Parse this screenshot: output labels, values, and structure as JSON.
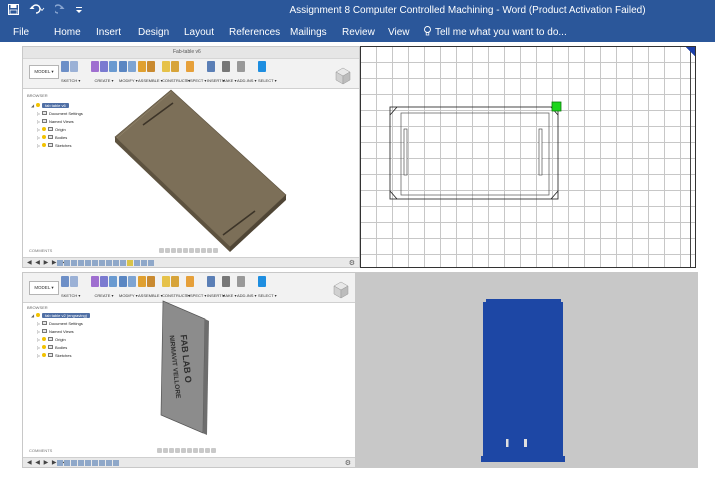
{
  "window": {
    "title": "Assignment 8 Computer Controlled Machining - Word (Product Activation Failed)",
    "save_icon": "save-icon",
    "undo_icon": "undo-icon",
    "redo_icon": "redo-icon",
    "customize_icon": "customize-quick-access-icon"
  },
  "ribbon": {
    "tabs": [
      "File",
      "Home",
      "Insert",
      "Design",
      "Layout",
      "References",
      "Mailings",
      "Review",
      "View"
    ],
    "tell_me": "Tell me what you want to do..."
  },
  "fusion_top": {
    "file_name": "Fab-table v6",
    "model_label": "MODEL ▾",
    "toolbar_groups": [
      "SKETCH ▾",
      "CREATE ▾",
      "MODIFY ▾",
      "ASSEMBLE ▾",
      "CONSTRUCT ▾",
      "INSPECT ▾",
      "INSERT ▾",
      "MAKE ▾",
      "ADD-INS ▾",
      "SELECT ▾"
    ],
    "browser_label": "BROWSER",
    "root_label": "fab table v6",
    "tree": [
      "Document Settings",
      "Named Views",
      "Origin",
      "Bodies",
      "Sketches"
    ],
    "comments_label": "COMMENTS"
  },
  "fusion_bottom": {
    "model_label": "MODEL ▾",
    "toolbar_groups": [
      "SKETCH ▾",
      "CREATE ▾",
      "MODIFY ▾",
      "ASSEMBLE ▾",
      "CONSTRUCT ▾",
      "INSPECT ▾",
      "INSERT ▾",
      "MAKE ▾",
      "ADD-INS ▾",
      "SELECT ▾"
    ],
    "browser_label": "BROWSER",
    "root_label": "fab table v2 (engraving)",
    "tree": [
      "Document Settings",
      "Named Views",
      "Origin",
      "Bodies",
      "Sketches"
    ],
    "comments_label": "COMMENTS",
    "engraving_line1": "FAB LAB O",
    "engraving_line2": "NIRMAVIT VELLORE"
  },
  "colors": {
    "word_blue": "#2b579a",
    "board_top": "#7c6f58",
    "board_side": "#5d523f",
    "panel_gray": "#8c8c8c",
    "preview_blue": "#1d47a5",
    "preview_bg": "#c8c8c8",
    "sketch_handle": "#1bd61b"
  }
}
